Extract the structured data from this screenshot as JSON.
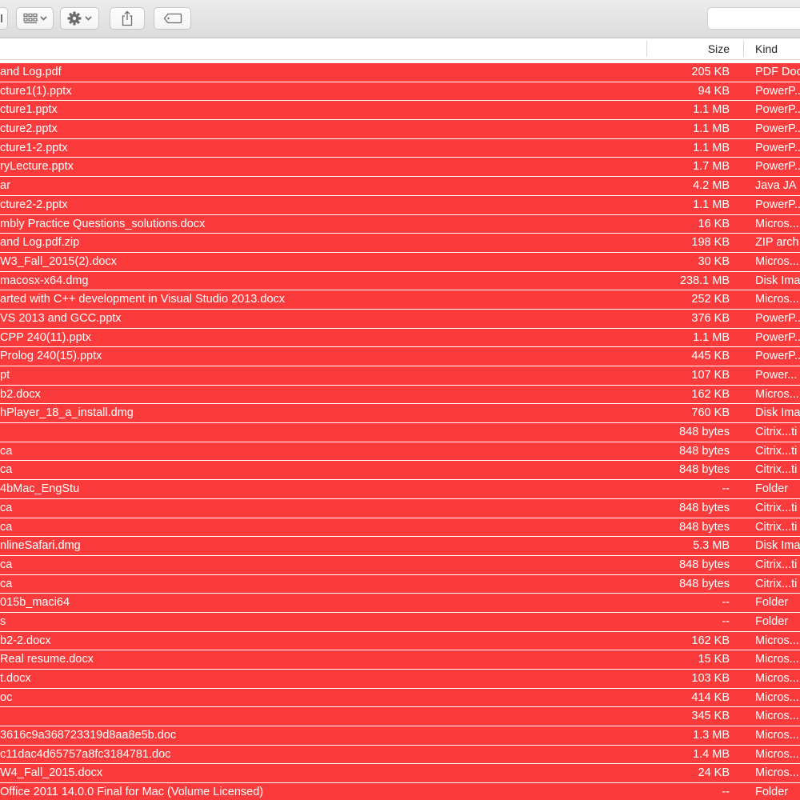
{
  "window": {
    "toolbar": {
      "arrange_icon": "list-view-grid-icon",
      "action_icon": "gear-icon",
      "share_icon": "share-icon",
      "tags_icon": "tag-icon",
      "search_placeholder": ""
    },
    "columns": {
      "size": "Size",
      "kind": "Kind"
    },
    "row_color": "#fb3b3b",
    "files": [
      {
        "name": "and Log.pdf",
        "size": "205 KB",
        "kind": "PDF Doc"
      },
      {
        "name": "cture1(1).pptx",
        "size": "94 KB",
        "kind": "PowerP..."
      },
      {
        "name": "cture1.pptx",
        "size": "1.1 MB",
        "kind": "PowerP..."
      },
      {
        "name": "cture2.pptx",
        "size": "1.1 MB",
        "kind": "PowerP..."
      },
      {
        "name": "cture1-2.pptx",
        "size": "1.1 MB",
        "kind": "PowerP..."
      },
      {
        "name": "ryLecture.pptx",
        "size": "1.7 MB",
        "kind": "PowerP..."
      },
      {
        "name": "ar",
        "size": "4.2 MB",
        "kind": "Java JA"
      },
      {
        "name": "cture2-2.pptx",
        "size": "1.1 MB",
        "kind": "PowerP..."
      },
      {
        "name": "mbly Practice Questions_solutions.docx",
        "size": "16 KB",
        "kind": "Micros..."
      },
      {
        "name": "and Log.pdf.zip",
        "size": "198 KB",
        "kind": "ZIP arch"
      },
      {
        "name": "W3_Fall_2015(2).docx",
        "size": "30 KB",
        "kind": "Micros..."
      },
      {
        "name": "macosx-x64.dmg",
        "size": "238.1 MB",
        "kind": "Disk Ima"
      },
      {
        "name": "arted with C++ development in Visual Studio 2013.docx",
        "size": "252 KB",
        "kind": "Micros..."
      },
      {
        "name": "VS 2013 and GCC.pptx",
        "size": "376 KB",
        "kind": "PowerP..."
      },
      {
        "name": "CPP 240(11).pptx",
        "size": "1.1 MB",
        "kind": "PowerP..."
      },
      {
        "name": "Prolog 240(15).pptx",
        "size": "445 KB",
        "kind": "PowerP..."
      },
      {
        "name": "pt",
        "size": "107 KB",
        "kind": "Power..."
      },
      {
        "name": "b2.docx",
        "size": "162 KB",
        "kind": "Micros..."
      },
      {
        "name": "hPlayer_18_a_install.dmg",
        "size": "760 KB",
        "kind": "Disk Ima"
      },
      {
        "name": "",
        "size": "848 bytes",
        "kind": "Citrix...ti"
      },
      {
        "name": "ca",
        "size": "848 bytes",
        "kind": "Citrix...ti"
      },
      {
        "name": "ca",
        "size": "848 bytes",
        "kind": "Citrix...ti"
      },
      {
        "name": "4bMac_EngStu",
        "size": "--",
        "kind": "Folder"
      },
      {
        "name": "ca",
        "size": "848 bytes",
        "kind": "Citrix...ti"
      },
      {
        "name": "ca",
        "size": "848 bytes",
        "kind": "Citrix...ti"
      },
      {
        "name": "nlineSafari.dmg",
        "size": "5.3 MB",
        "kind": "Disk Ima"
      },
      {
        "name": "ca",
        "size": "848 bytes",
        "kind": "Citrix...ti"
      },
      {
        "name": "ca",
        "size": "848 bytes",
        "kind": "Citrix...ti"
      },
      {
        "name": "015b_maci64",
        "size": "--",
        "kind": "Folder"
      },
      {
        "name": "s",
        "size": "--",
        "kind": "Folder"
      },
      {
        "name": "b2-2.docx",
        "size": "162 KB",
        "kind": "Micros..."
      },
      {
        "name": "Real resume.docx",
        "size": "15 KB",
        "kind": "Micros..."
      },
      {
        "name": "t.docx",
        "size": "103 KB",
        "kind": "Micros..."
      },
      {
        "name": "oc",
        "size": "414 KB",
        "kind": "Micros..."
      },
      {
        "name": "",
        "size": "345 KB",
        "kind": "Micros..."
      },
      {
        "name": "3616c9a368723319d8aa8e5b.doc",
        "size": "1.3 MB",
        "kind": "Micros..."
      },
      {
        "name": "c11dac4d65757a8fc3184781.doc",
        "size": "1.4 MB",
        "kind": "Micros..."
      },
      {
        "name": "W4_Fall_2015.docx",
        "size": "24 KB",
        "kind": "Micros..."
      },
      {
        "name": "Office 2011 14.0.0 Final for Mac (Volume Licensed)",
        "size": "--",
        "kind": "Folder"
      }
    ]
  }
}
